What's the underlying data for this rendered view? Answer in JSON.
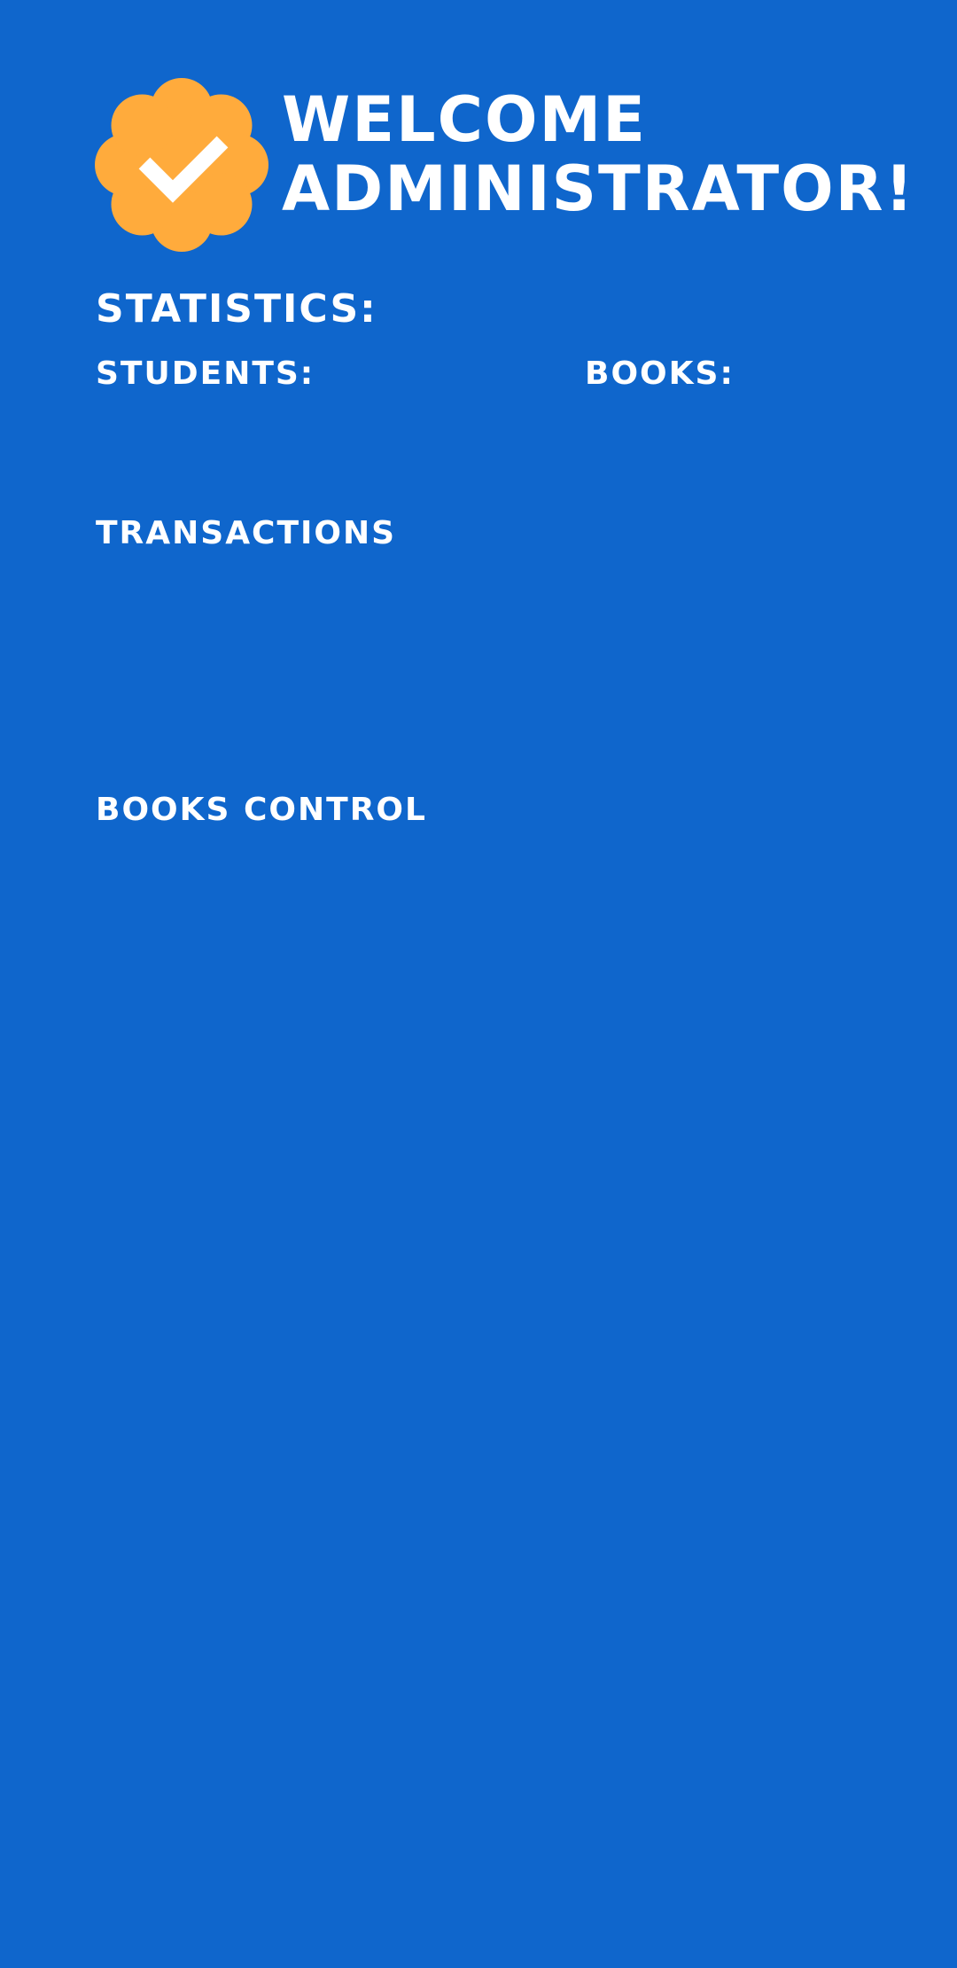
{
  "colors": {
    "background": "#0f66cc",
    "badge": "#ffab3c",
    "text": "#ffffff"
  },
  "header": {
    "badge_icon": "verified-check-icon",
    "title_line1": "WELCOME",
    "title_line2": "ADMINISTRATOR!"
  },
  "statistics": {
    "heading": "STATISTICS:",
    "students_label": "STUDENTS:",
    "students_value": "",
    "books_label": "BOOKS:",
    "books_value": ""
  },
  "sections": {
    "transactions_label": "TRANSACTIONS",
    "books_control_label": "BOOKS CONTROL"
  }
}
